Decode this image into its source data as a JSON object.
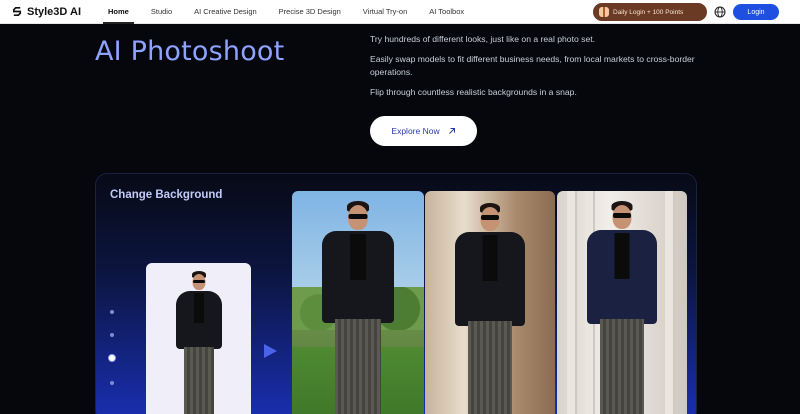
{
  "brand": {
    "name": "Style3D AI"
  },
  "nav": {
    "items": [
      {
        "label": "Home",
        "active": true
      },
      {
        "label": "Studio"
      },
      {
        "label": "AI Creative Design"
      },
      {
        "label": "Precise 3D Design"
      },
      {
        "label": "Virtual Try-on"
      },
      {
        "label": "AI Toolbox"
      }
    ],
    "daily_login": "Daily Login + 100 Points",
    "login": "Login"
  },
  "hero": {
    "title": "AI Photoshoot",
    "paragraphs": [
      "Try hundreds of different looks, just like on a real photo set.",
      "Easily swap models to fit different business needs, from local markets to cross-border operations.",
      "Flip through countless realistic backgrounds in a snap."
    ],
    "cta": "Explore Now"
  },
  "showcase": {
    "title": "Change Background",
    "dots_count": 4,
    "active_dot": 3,
    "backgrounds": [
      "outdoor-garden",
      "sheer-curtains",
      "marble-columns"
    ]
  },
  "colors": {
    "accent": "#1f4fe0",
    "hero_title": "#8ea2ff",
    "page_bg": "#05070c",
    "daily_badge": "#6b3a24"
  }
}
